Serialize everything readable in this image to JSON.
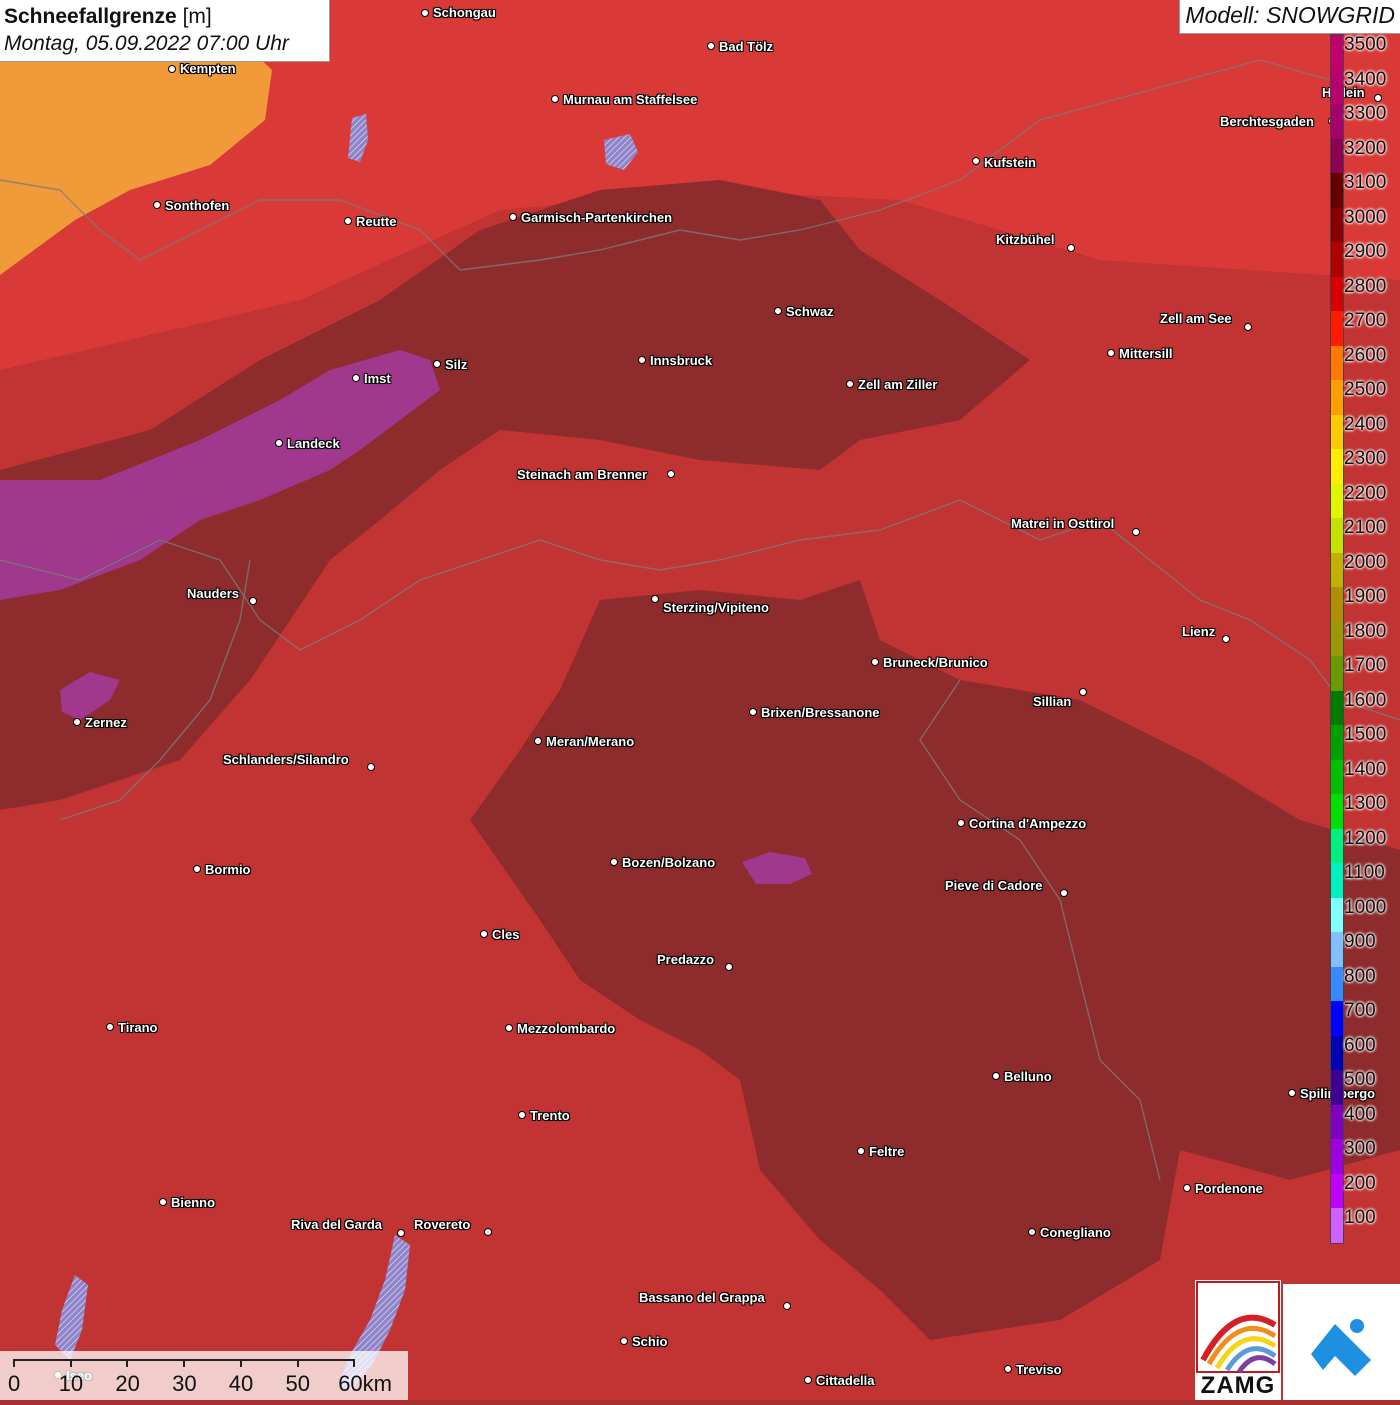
{
  "header": {
    "title_bold": "Schneefallgrenze",
    "title_unit": "[m]",
    "datetime": "Montag, 05.09.2022 07:00 Uhr"
  },
  "model": {
    "label": "Modell: SNOWGRID"
  },
  "legend": {
    "labels": [
      "3500",
      "3400",
      "3300",
      "3200",
      "3100",
      "3000",
      "2900",
      "2800",
      "2700",
      "2600",
      "2500",
      "2400",
      "2300",
      "2200",
      "2100",
      "2000",
      "1900",
      "1800",
      "1700",
      "1600",
      "1500",
      "1400",
      "1300",
      "1200",
      "1100",
      "1000",
      "900",
      "800",
      "700",
      "600",
      "500",
      "400",
      "300",
      "200",
      "100"
    ],
    "colors": [
      "#c2006b",
      "#b8006f",
      "#a8006a",
      "#8e0054",
      "#660000",
      "#8a0000",
      "#b00000",
      "#d80000",
      "#ff1a00",
      "#ff7800",
      "#ff9e00",
      "#ffc800",
      "#ffee00",
      "#e0f500",
      "#c8e000",
      "#c0b000",
      "#b09000",
      "#9a9a00",
      "#6a9a00",
      "#007a00",
      "#00a000",
      "#00c000",
      "#00e000",
      "#00f080",
      "#00f0c0",
      "#80ffff",
      "#80c0ff",
      "#3a8aff",
      "#0000ff",
      "#0000b0",
      "#400090",
      "#8000c0",
      "#a000e0",
      "#c000ff",
      "#d060ff"
    ]
  },
  "scalebar": {
    "ticks": [
      "0",
      "10",
      "20",
      "30",
      "40",
      "50",
      "60km"
    ]
  },
  "logos": {
    "zamg": "ZAMG"
  },
  "cities": [
    {
      "name": "Schongau"
    },
    {
      "name": "Bad Tölz"
    },
    {
      "name": "Kempten"
    },
    {
      "name": "Murnau am Staffelsee"
    },
    {
      "name": "Hallein"
    },
    {
      "name": "Berchtesgaden"
    },
    {
      "name": "Kufstein"
    },
    {
      "name": "Sonthofen"
    },
    {
      "name": "Reutte"
    },
    {
      "name": "Garmisch-Partenkirchen"
    },
    {
      "name": "Kitzbühel"
    },
    {
      "name": "Schwaz"
    },
    {
      "name": "Zell am See"
    },
    {
      "name": "Mittersill"
    },
    {
      "name": "Innsbruck"
    },
    {
      "name": "Silz"
    },
    {
      "name": "Imst"
    },
    {
      "name": "Zell am Ziller"
    },
    {
      "name": "Landeck"
    },
    {
      "name": "Steinach am Brenner"
    },
    {
      "name": "Matrei in Osttirol"
    },
    {
      "name": "Nauders"
    },
    {
      "name": "Sterzing/Vipiteno"
    },
    {
      "name": "Lienz"
    },
    {
      "name": "Bruneck/Brunico"
    },
    {
      "name": "Sillian"
    },
    {
      "name": "Zernez"
    },
    {
      "name": "Brixen/Bressanone"
    },
    {
      "name": "Meran/Merano"
    },
    {
      "name": "Schlanders/Silandro"
    },
    {
      "name": "Cortina d'Ampezzo"
    },
    {
      "name": "Bormio"
    },
    {
      "name": "Bozen/Bolzano"
    },
    {
      "name": "Pieve di Cadore"
    },
    {
      "name": "Cles"
    },
    {
      "name": "Predazzo"
    },
    {
      "name": "Tirano"
    },
    {
      "name": "Mezzolombardo"
    },
    {
      "name": "Belluno"
    },
    {
      "name": "Spilimbergo"
    },
    {
      "name": "Trento"
    },
    {
      "name": "Feltre"
    },
    {
      "name": "Pordenone"
    },
    {
      "name": "Bienno"
    },
    {
      "name": "Riva del Garda"
    },
    {
      "name": "Rovereto"
    },
    {
      "name": "Conegliano"
    },
    {
      "name": "Bassano del Grappa"
    },
    {
      "name": "Schio"
    },
    {
      "name": "Treviso"
    },
    {
      "name": "Cittadella"
    },
    {
      "name": "Iseo"
    }
  ]
}
